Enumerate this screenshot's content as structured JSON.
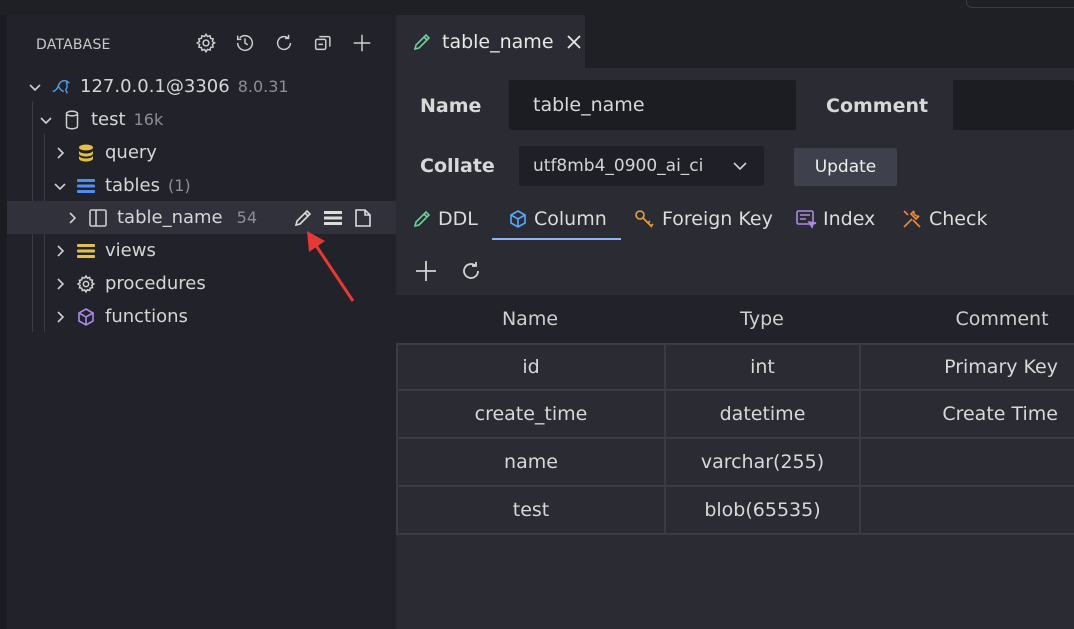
{
  "sidebar": {
    "header": "DATABASE",
    "tools": [
      {
        "name": "settings-icon"
      },
      {
        "name": "history-icon"
      },
      {
        "name": "refresh-icon"
      },
      {
        "name": "collapse-all-icon"
      },
      {
        "name": "add-icon"
      }
    ],
    "connection": {
      "label": "127.0.0.1@3306",
      "version": "8.0.31"
    },
    "database": {
      "label": "test",
      "size": "16k"
    },
    "query": {
      "label": "query"
    },
    "tables": {
      "label": "tables",
      "count": "(1)"
    },
    "table_item": {
      "label": "table_name",
      "count": "54"
    },
    "views": {
      "label": "views"
    },
    "procedures": {
      "label": "procedures"
    },
    "functions": {
      "label": "functions"
    }
  },
  "tab": {
    "label": "table_name"
  },
  "form": {
    "name_label": "Name",
    "name_value": "table_name",
    "comment_label": "Comment",
    "comment_value": "",
    "collate_label": "Collate",
    "collate_value": "utf8mb4_0900_ai_ci",
    "update_label": "Update"
  },
  "subtabs": [
    {
      "label": "DDL",
      "icon": "pencil-icon"
    },
    {
      "label": "Column",
      "icon": "cube-icon",
      "active": true
    },
    {
      "label": "Foreign Key",
      "icon": "key-icon"
    },
    {
      "label": "Index",
      "icon": "index-icon"
    },
    {
      "label": "Check",
      "icon": "tools-icon"
    }
  ],
  "columns_table": {
    "headers": [
      "Name",
      "Type",
      "Comment"
    ],
    "rows": [
      [
        "id",
        "int",
        "Primary Key"
      ],
      [
        "create_time",
        "datetime",
        "Create Time"
      ],
      [
        "name",
        "varchar(255)",
        ""
      ],
      [
        "test",
        "blob(65535)",
        ""
      ]
    ]
  },
  "colors": {
    "accent": "#8ab4f8",
    "arrow": "#e53935",
    "tables_icon": "#4f8ef7",
    "query_icon": "#e5c046",
    "views_icon": "#e5c046",
    "functions_icon": "#a98be5"
  }
}
